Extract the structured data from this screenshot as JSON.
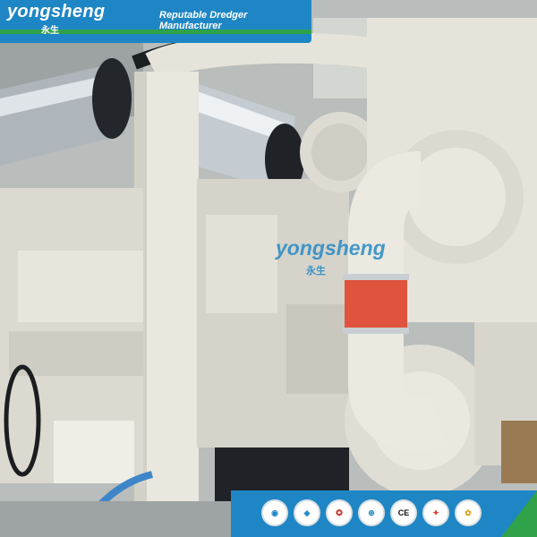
{
  "banner": {
    "brand": "yongsheng",
    "brand_cn": "永生",
    "tagline": "Reputable Dredger Manufacturer"
  },
  "watermark": {
    "brand": "yongsheng",
    "brand_cn": "永生"
  },
  "certifications": {
    "icons": [
      "rina-icon",
      "bv-icon",
      "ccs-icon",
      "iso-icon",
      "ce-icon",
      "sgs-icon",
      "award-icon"
    ],
    "ce_mark": "CE"
  },
  "colors": {
    "brand_blue": "#1e86c4",
    "brand_green": "#2fa24a",
    "engine_white": "#e8e6dc",
    "hose_red": "#e0533d"
  }
}
